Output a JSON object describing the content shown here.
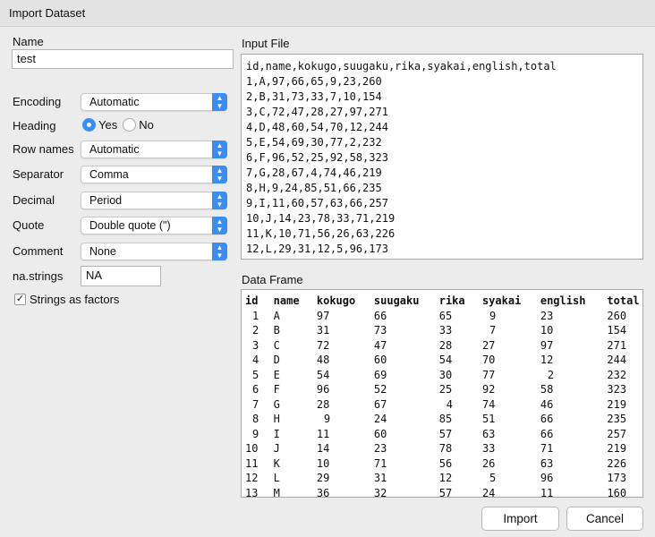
{
  "title": "Import Dataset",
  "name_label": "Name",
  "name_value": "test",
  "fields": {
    "encoding_label": "Encoding",
    "encoding_value": "Automatic",
    "heading_label": "Heading",
    "heading_yes": "Yes",
    "heading_no": "No",
    "rownames_label": "Row names",
    "rownames_value": "Automatic",
    "separator_label": "Separator",
    "separator_value": "Comma",
    "decimal_label": "Decimal",
    "decimal_value": "Period",
    "quote_label": "Quote",
    "quote_value": "Double quote (\")",
    "comment_label": "Comment",
    "comment_value": "None",
    "nastrings_label": "na.strings",
    "nastrings_value": "NA",
    "strings_factors_label": "Strings as factors"
  },
  "input_file_label": "Input File",
  "input_lines": [
    "id,name,kokugo,suugaku,rika,syakai,english,total",
    "1,A,97,66,65,9,23,260",
    "2,B,31,73,33,7,10,154",
    "3,C,72,47,28,27,97,271",
    "4,D,48,60,54,70,12,244",
    "5,E,54,69,30,77,2,232",
    "6,F,96,52,25,92,58,323",
    "7,G,28,67,4,74,46,219",
    "8,H,9,24,85,51,66,235",
    "9,I,11,60,57,63,66,257",
    "10,J,14,23,78,33,71,219",
    "11,K,10,71,56,26,63,226",
    "12,L,29,31,12,5,96,173",
    "13,M,36,32,57,24,11,160"
  ],
  "data_frame_label": "Data Frame",
  "columns": [
    "id",
    "name",
    "kokugo",
    "suugaku",
    "rika",
    "syakai",
    "english",
    "total"
  ],
  "rows": [
    [
      "1",
      "A",
      "97",
      "66",
      "65",
      "9",
      "23",
      "260"
    ],
    [
      "2",
      "B",
      "31",
      "73",
      "33",
      "7",
      "10",
      "154"
    ],
    [
      "3",
      "C",
      "72",
      "47",
      "28",
      "27",
      "97",
      "271"
    ],
    [
      "4",
      "D",
      "48",
      "60",
      "54",
      "70",
      "12",
      "244"
    ],
    [
      "5",
      "E",
      "54",
      "69",
      "30",
      "77",
      "2",
      "232"
    ],
    [
      "6",
      "F",
      "96",
      "52",
      "25",
      "92",
      "58",
      "323"
    ],
    [
      "7",
      "G",
      "28",
      "67",
      "4",
      "74",
      "46",
      "219"
    ],
    [
      "8",
      "H",
      "9",
      "24",
      "85",
      "51",
      "66",
      "235"
    ],
    [
      "9",
      "I",
      "11",
      "60",
      "57",
      "63",
      "66",
      "257"
    ],
    [
      "10",
      "J",
      "14",
      "23",
      "78",
      "33",
      "71",
      "219"
    ],
    [
      "11",
      "K",
      "10",
      "71",
      "56",
      "26",
      "63",
      "226"
    ],
    [
      "12",
      "L",
      "29",
      "31",
      "12",
      "5",
      "96",
      "173"
    ],
    [
      "13",
      "M",
      "36",
      "32",
      "57",
      "24",
      "11",
      "160"
    ]
  ],
  "buttons": {
    "import": "Import",
    "cancel": "Cancel"
  },
  "accent": "#3b8ef0"
}
